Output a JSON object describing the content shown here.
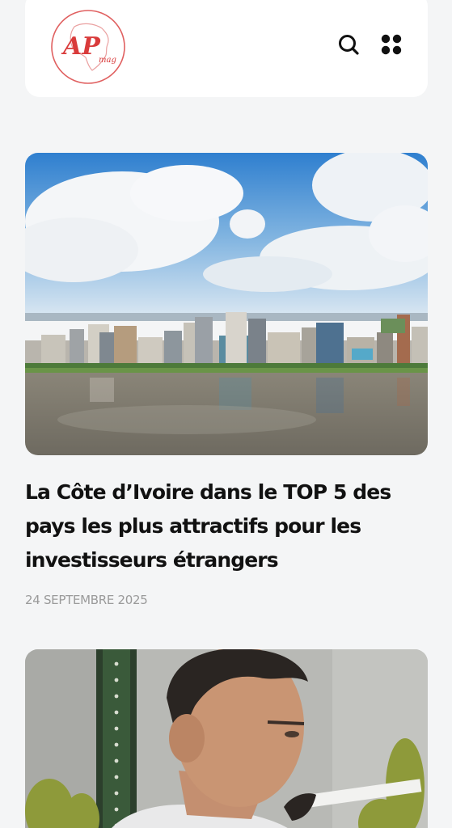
{
  "header": {
    "logo_text": "AP",
    "logo_sub": "mag",
    "icons": [
      "search-icon",
      "grid-menu-icon"
    ],
    "brand_color": "#d93b3b"
  },
  "articles": [
    {
      "title": "La Côte d’Ivoire dans le TOP 5 des pays les plus attractifs pour les investisseurs étrangers",
      "date": "24 SEPTEMBRE 2025",
      "image": "abidjan-skyline-lagoon-photo"
    },
    {
      "image": "man-portrait-photo"
    }
  ]
}
